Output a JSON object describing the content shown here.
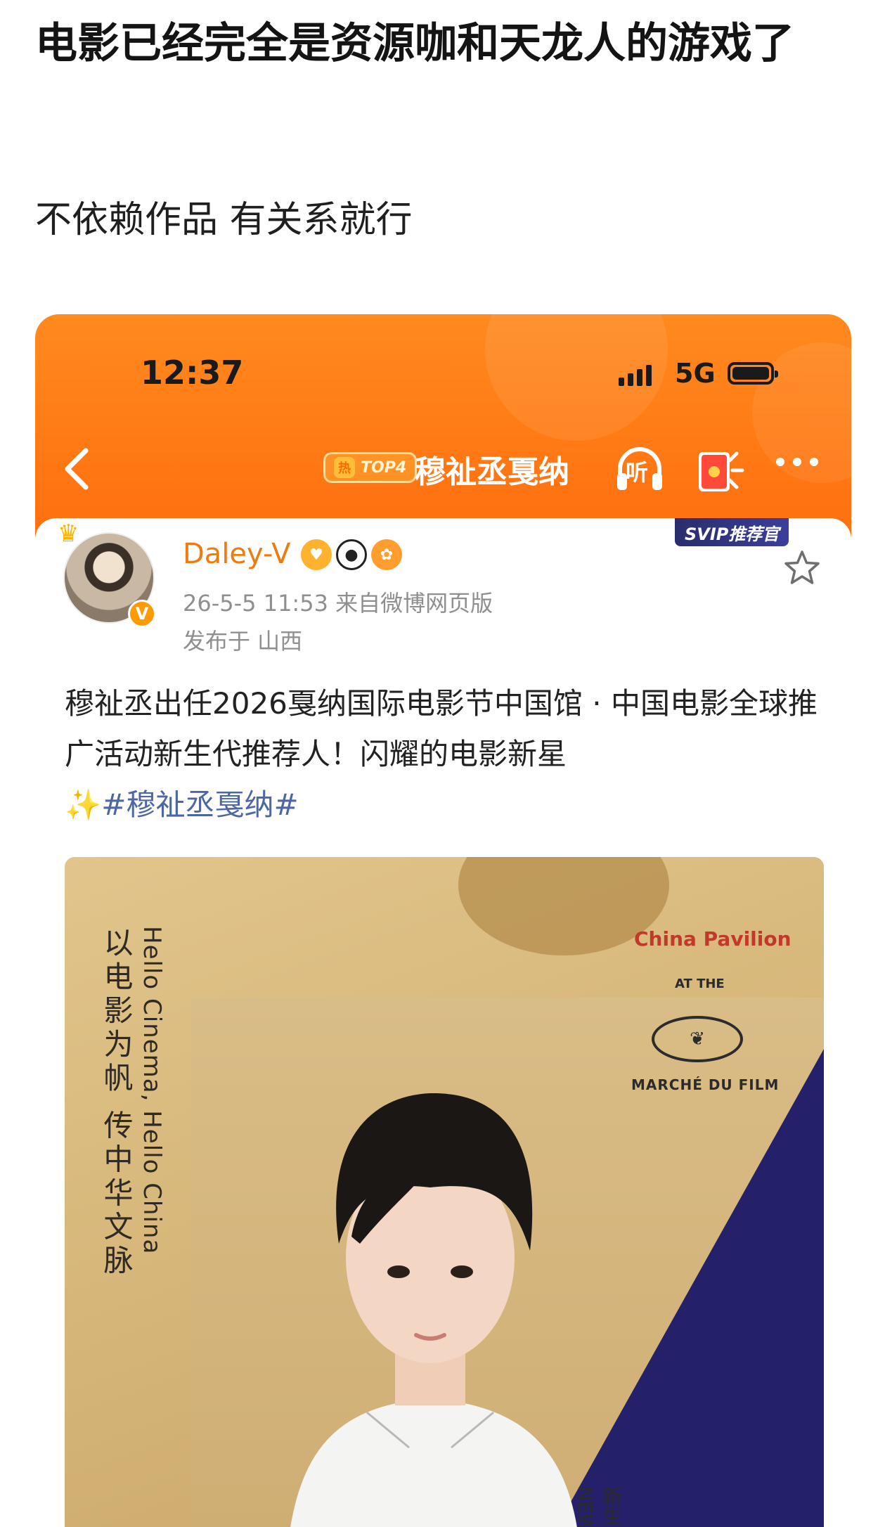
{
  "post": {
    "title": "电影已经完全是资源咖和天龙人的游戏了",
    "subtitle": "不依赖作品 有关系就行"
  },
  "screenshot": {
    "status_bar": {
      "time": "12:37",
      "network": "5G",
      "signal_icon": "signal-bars-icon",
      "battery_icon": "battery-icon"
    },
    "nav": {
      "back_icon": "chevron-left-icon",
      "topic_badge_hot": "热",
      "topic_badge_rank": "TOP4",
      "topic_title": "穆祉丞戛纳",
      "listen_label": "听",
      "listen_icon": "headphones-icon",
      "redpack_icon": "red-envelope-icon",
      "more_icon": "more-dots-icon"
    },
    "card": {
      "svip_tag": "SVIP推荐官",
      "username": "Daley-V",
      "verified_badge": "V",
      "user_badges": [
        "gold-badge-icon",
        "panda-icon",
        "pufferfish-icon"
      ],
      "timestamp_source": "26-5-5 11:53  来自微博网页版",
      "location": "发布于 山西",
      "favorite_icon": "star-outline-icon",
      "body_text": "穆祉丞出任2026戛纳国际电影节中国馆 · 中国电影全球推广活动新生代推荐人！闪耀的电影新星",
      "sparkle": "✨",
      "hashtag": "#穆祉丞戛纳#"
    },
    "poster": {
      "vertical_zh": "以电影为帆 传中华文脉",
      "vertical_en": "Hello Cinema, Hello China",
      "pavilion_title": "China Pavilion",
      "pavilion_at": "AT THE",
      "pavilion_logo": "palm-leaf-logo",
      "pavilion_sub": "MARCHÉ DU FILM",
      "corner_note": "新生 NEW",
      "colors": {
        "gold": "#d7b77a",
        "navy": "#24206a",
        "red": "#c0392b"
      }
    },
    "colors": {
      "header_orange": "#ff7a14",
      "username_orange": "#ee7a12",
      "hashtag_blue": "#4d67a6",
      "meta_gray": "#8f8f8f"
    }
  }
}
